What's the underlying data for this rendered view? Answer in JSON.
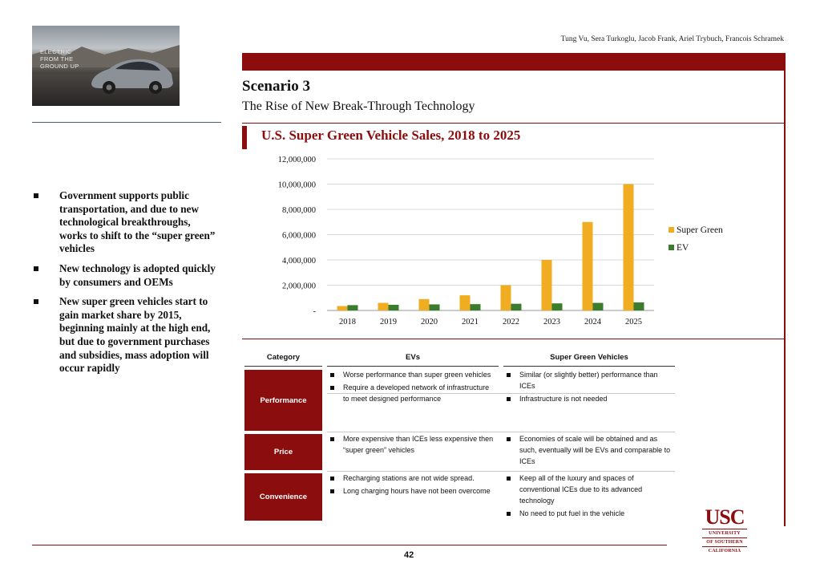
{
  "photo": {
    "tagline": "ELECTRIC\nFROM THE\nGROUND UP"
  },
  "header": {
    "authors": "Tung Vu, Sera Turkoglu, Jacob Frank, Ariel Trybuch, Francois Schramek"
  },
  "slide": {
    "title": "Scenario 3",
    "subtitle": "The Rise of New Break-Through Technology"
  },
  "bullets": [
    "Government supports public transportation, and due to new technological breakthroughs, works to shift to the “super green” vehicles",
    "New technology is adopted quickly by consumers and OEMs",
    "New super green vehicles start to gain market share by 2015, beginning mainly at the high end, but due to government purchases and subsidies, mass adoption will occur rapidly"
  ],
  "chart_data": {
    "type": "bar",
    "title": "U.S. Super Green Vehicle Sales, 2018 to 2025",
    "categories": [
      "2018",
      "2019",
      "2020",
      "2021",
      "2022",
      "2023",
      "2024",
      "2025"
    ],
    "series": [
      {
        "name": "Super Green",
        "color": "#f0ad22",
        "values": [
          350000,
          600000,
          900000,
          1200000,
          2000000,
          4000000,
          7000000,
          10000000
        ]
      },
      {
        "name": "EV",
        "color": "#3a7d2c",
        "values": [
          420000,
          450000,
          480000,
          500000,
          530000,
          560000,
          600000,
          640000
        ]
      }
    ],
    "yticks": [
      "-",
      "2,000,000",
      "4,000,000",
      "6,000,000",
      "8,000,000",
      "10,000,000",
      "12,000,000"
    ],
    "ylim": [
      0,
      12000000
    ],
    "grid": true,
    "legend": "right"
  },
  "table": {
    "headers": {
      "category": "Category",
      "evs": "EVs",
      "super_green": "Super Green Vehicles"
    },
    "rows": [
      {
        "category": "Performance",
        "evs": [
          "Worse performance than super green vehicles",
          "Require a developed network of infrastructure to meet designed performance"
        ],
        "super_green": [
          "Similar (or slightly better) performance than ICEs",
          "Infrastructure is not needed"
        ]
      },
      {
        "category": "Price",
        "evs": [
          "More expensive than ICEs less expensive then “super green” vehicles"
        ],
        "super_green": [
          "Economies of scale will be obtained and as such, eventually will be EVs and comparable to ICEs"
        ]
      },
      {
        "category": "Convenience",
        "evs": [
          "Recharging stations are not wide spread.",
          "Long charging hours have not been overcome"
        ],
        "super_green": [
          "Keep all of the luxury and spaces of conventional ICEs due to its advanced technology",
          "No need to put fuel in the vehicle"
        ]
      }
    ]
  },
  "footer": {
    "page_number": "42"
  },
  "logo": {
    "abbr": "USC",
    "line1": "UNIVERSITY",
    "line2": "OF SOUTHERN",
    "line3": "CALIFORNIA"
  }
}
